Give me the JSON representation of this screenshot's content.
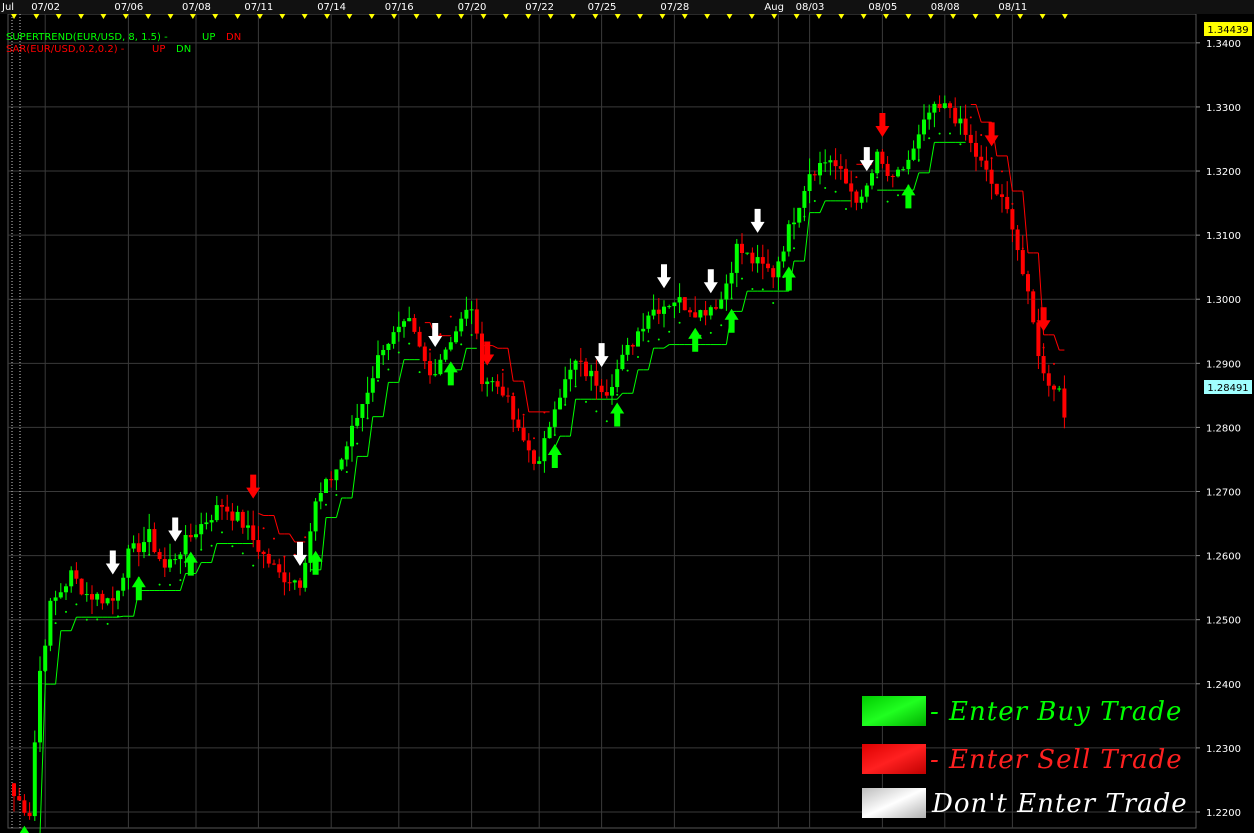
{
  "indicators": {
    "supertrend": {
      "label": "SUPERTREND(EUR/USD, 8, 1.5) -",
      "up": "UP",
      "dn": "DN"
    },
    "sar": {
      "label": "SAR(EUR/USD,0.2,0.2) -",
      "up": "UP",
      "dn": "DN"
    }
  },
  "price_badges": {
    "top": "1.34439",
    "last": "1.28491"
  },
  "legend": [
    {
      "label": "- Enter Buy Trade",
      "color": "#00ff00",
      "text_color": "#00ff00"
    },
    {
      "label": "- Enter Sell Trade",
      "color": "#ff0000",
      "text_color": "#ff2020"
    },
    {
      "label": "Don't Enter Trade",
      "color": "#d8d8d8",
      "text_color": "#ffffff"
    }
  ],
  "colors": {
    "up": "#00ff00",
    "down": "#ff0000",
    "neutral": "#ffffff",
    "grid": "#3a3a3a",
    "badge_top": "#ffff00",
    "badge_last": "#a0ffff"
  },
  "chart_data": {
    "type": "candlestick",
    "symbol": "EUR/USD",
    "ylim": [
      1.2175,
      1.3445
    ],
    "y_ticks": [
      1.22,
      1.23,
      1.24,
      1.25,
      1.26,
      1.27,
      1.28,
      1.29,
      1.3,
      1.31,
      1.32,
      1.33,
      1.34
    ],
    "x_tick_labels": [
      {
        "label": "Jul",
        "bar": 0
      },
      {
        "label": "07/02",
        "bar": 6
      },
      {
        "label": "07/06",
        "bar": 22
      },
      {
        "label": "07/08",
        "bar": 35
      },
      {
        "label": "07/11",
        "bar": 47
      },
      {
        "label": "07/14",
        "bar": 61
      },
      {
        "label": "07/16",
        "bar": 74
      },
      {
        "label": "07/20",
        "bar": 88
      },
      {
        "label": "07/22",
        "bar": 101
      },
      {
        "label": "07/25",
        "bar": 113
      },
      {
        "label": "07/28",
        "bar": 127
      },
      {
        "label": "Aug",
        "bar": 147
      },
      {
        "label": "08/03",
        "bar": 153
      },
      {
        "label": "08/05",
        "bar": 167
      },
      {
        "label": "08/08",
        "bar": 179
      },
      {
        "label": "08/11",
        "bar": 192
      }
    ],
    "anchors": [
      {
        "bar": 0,
        "close": 1.2225
      },
      {
        "bar": 3,
        "close": 1.22
      },
      {
        "bar": 5,
        "close": 1.242
      },
      {
        "bar": 7,
        "close": 1.252
      },
      {
        "bar": 11,
        "close": 1.257
      },
      {
        "bar": 14,
        "close": 1.254
      },
      {
        "bar": 19,
        "close": 1.253
      },
      {
        "bar": 22,
        "close": 1.26
      },
      {
        "bar": 26,
        "close": 1.263
      },
      {
        "bar": 29,
        "close": 1.258
      },
      {
        "bar": 35,
        "close": 1.264
      },
      {
        "bar": 40,
        "close": 1.268
      },
      {
        "bar": 44,
        "close": 1.265
      },
      {
        "bar": 48,
        "close": 1.26
      },
      {
        "bar": 51,
        "close": 1.257
      },
      {
        "bar": 55,
        "close": 1.256
      },
      {
        "bar": 58,
        "close": 1.268
      },
      {
        "bar": 63,
        "close": 1.275
      },
      {
        "bar": 68,
        "close": 1.286
      },
      {
        "bar": 71,
        "close": 1.293
      },
      {
        "bar": 76,
        "close": 1.296
      },
      {
        "bar": 80,
        "close": 1.288
      },
      {
        "bar": 84,
        "close": 1.294
      },
      {
        "bar": 88,
        "close": 1.299
      },
      {
        "bar": 90,
        "close": 1.288
      },
      {
        "bar": 94,
        "close": 1.286
      },
      {
        "bar": 97,
        "close": 1.279
      },
      {
        "bar": 101,
        "close": 1.274
      },
      {
        "bar": 104,
        "close": 1.284
      },
      {
        "bar": 108,
        "close": 1.29
      },
      {
        "bar": 111,
        "close": 1.288
      },
      {
        "bar": 114,
        "close": 1.286
      },
      {
        "bar": 118,
        "close": 1.292
      },
      {
        "bar": 122,
        "close": 1.298
      },
      {
        "bar": 127,
        "close": 1.3
      },
      {
        "bar": 132,
        "close": 1.298
      },
      {
        "bar": 136,
        "close": 1.3
      },
      {
        "bar": 139,
        "close": 1.308
      },
      {
        "bar": 142,
        "close": 1.306
      },
      {
        "bar": 146,
        "close": 1.304
      },
      {
        "bar": 150,
        "close": 1.313
      },
      {
        "bar": 153,
        "close": 1.32
      },
      {
        "bar": 157,
        "close": 1.322
      },
      {
        "bar": 160,
        "close": 1.318
      },
      {
        "bar": 163,
        "close": 1.315
      },
      {
        "bar": 166,
        "close": 1.322
      },
      {
        "bar": 169,
        "close": 1.318
      },
      {
        "bar": 173,
        "close": 1.323
      },
      {
        "bar": 176,
        "close": 1.329
      },
      {
        "bar": 180,
        "close": 1.33
      },
      {
        "bar": 184,
        "close": 1.324
      },
      {
        "bar": 188,
        "close": 1.318
      },
      {
        "bar": 192,
        "close": 1.312
      },
      {
        "bar": 195,
        "close": 1.3
      },
      {
        "bar": 198,
        "close": 1.288
      },
      {
        "bar": 201,
        "close": 1.286
      },
      {
        "bar": 202,
        "close": 1.282
      }
    ],
    "signals": [
      {
        "bar": 2,
        "type": "buy"
      },
      {
        "bar": 19,
        "type": "none"
      },
      {
        "bar": 24,
        "type": "buy"
      },
      {
        "bar": 31,
        "type": "none"
      },
      {
        "bar": 34,
        "type": "buy"
      },
      {
        "bar": 46,
        "type": "sell"
      },
      {
        "bar": 55,
        "type": "none"
      },
      {
        "bar": 58,
        "type": "buy"
      },
      {
        "bar": 81,
        "type": "none"
      },
      {
        "bar": 84,
        "type": "buy"
      },
      {
        "bar": 91,
        "type": "sell"
      },
      {
        "bar": 104,
        "type": "buy"
      },
      {
        "bar": 113,
        "type": "none"
      },
      {
        "bar": 116,
        "type": "buy"
      },
      {
        "bar": 125,
        "type": "none"
      },
      {
        "bar": 131,
        "type": "buy"
      },
      {
        "bar": 134,
        "type": "none"
      },
      {
        "bar": 138,
        "type": "buy"
      },
      {
        "bar": 143,
        "type": "none"
      },
      {
        "bar": 149,
        "type": "buy"
      },
      {
        "bar": 164,
        "type": "none"
      },
      {
        "bar": 167,
        "type": "sell"
      },
      {
        "bar": 172,
        "type": "buy"
      },
      {
        "bar": 188,
        "type": "sell"
      },
      {
        "bar": 198,
        "type": "sell"
      }
    ]
  }
}
